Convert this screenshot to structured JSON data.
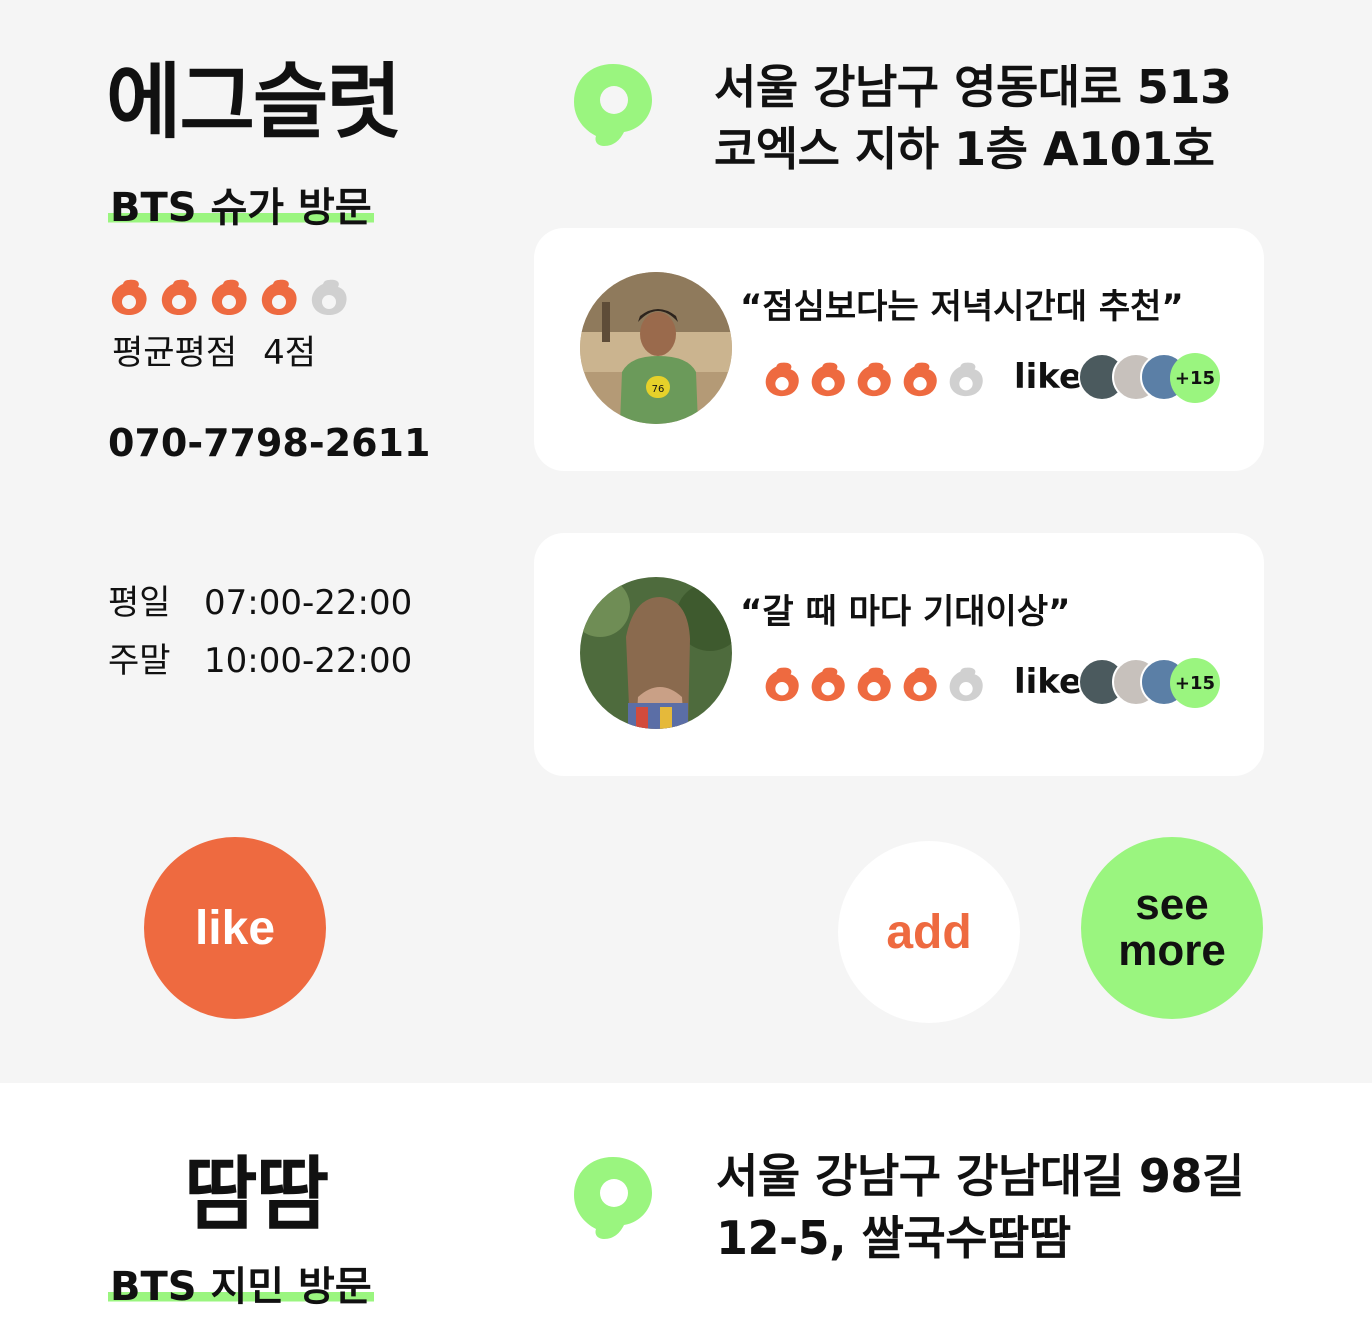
{
  "colors": {
    "accent_orange": "#ee6a40",
    "accent_green": "#9af57f",
    "inactive_gray": "#d0d0d0",
    "background": "#f5f5f5"
  },
  "restaurants": [
    {
      "name": "에그슬럿",
      "visit": "BTS 슈가 방문",
      "rating": 4,
      "rating_max": 5,
      "rating_label": "평균평점",
      "rating_text": "4점",
      "phone": "070-7798-2611",
      "hours": [
        {
          "day": "평일",
          "time": "07:00-22:00"
        },
        {
          "day": "주말",
          "time": "10:00-22:00"
        }
      ],
      "address_line1": "서울 강남구 영동대로 513",
      "address_line2": "코엑스 지하 1층 A101호",
      "reviews": [
        {
          "quote": "“점심보다는 저녁시간대 추천”",
          "rating": 4,
          "like_label": "like",
          "likers_more": "+15",
          "photo": "runner-photo"
        },
        {
          "quote": "“갈 때 마다 기대이상”",
          "rating": 4,
          "like_label": "like",
          "likers_more": "+15",
          "photo": "long-hair-photo"
        }
      ],
      "buttons": {
        "like": "like",
        "add": "add",
        "see_more_1": "see",
        "see_more_2": "more"
      }
    },
    {
      "name": "땀땀",
      "visit": "BTS 지민 방문",
      "address_line1": "서울 강남구 강남대길 98길",
      "address_line2": "12-5, 쌀국수땀땀"
    }
  ]
}
